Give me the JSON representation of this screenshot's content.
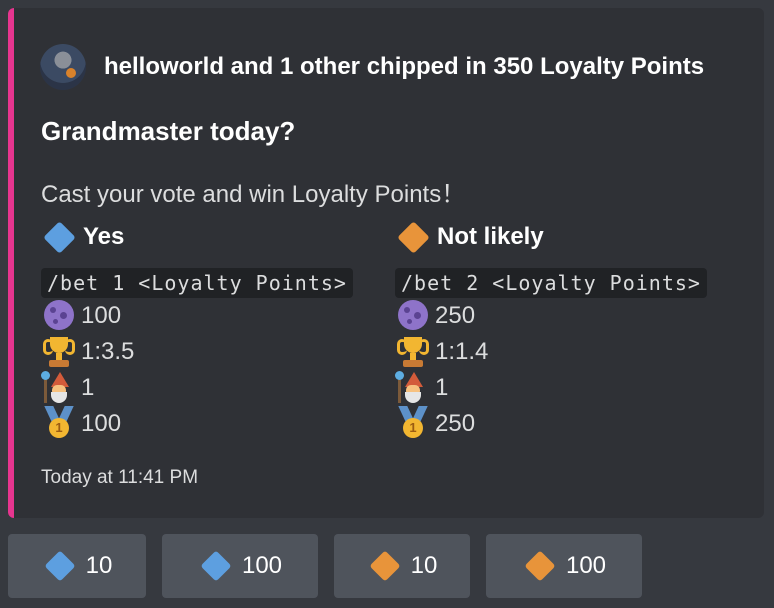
{
  "colors": {
    "blue_diamond": "#5d9fe0",
    "orange_diamond": "#e8943a",
    "embed_accent": "#e6358f"
  },
  "embed": {
    "author": "helloworld and 1 other chipped in 350 Loyalty Points",
    "title": "Grandmaster today?",
    "description": "Cast your vote and win Loyalty Points！",
    "timestamp": "Today at 11:41 PM",
    "fields": [
      {
        "name": "Yes",
        "icon": "blue-diamond-icon",
        "command": "/bet 1 <Loyalty Points>",
        "points": "100",
        "odds": "1:3.5",
        "voters": "1",
        "top_bet": "100"
      },
      {
        "name": "Not likely",
        "icon": "orange-diamond-icon",
        "command": "/bet 2 <Loyalty Points>",
        "points": "250",
        "odds": "1:1.4",
        "voters": "1",
        "top_bet": "250"
      }
    ]
  },
  "buttons": [
    {
      "label": "10",
      "icon": "blue-diamond-icon"
    },
    {
      "label": "100",
      "icon": "blue-diamond-icon"
    },
    {
      "label": "10",
      "icon": "orange-diamond-icon"
    },
    {
      "label": "100",
      "icon": "orange-diamond-icon"
    }
  ]
}
